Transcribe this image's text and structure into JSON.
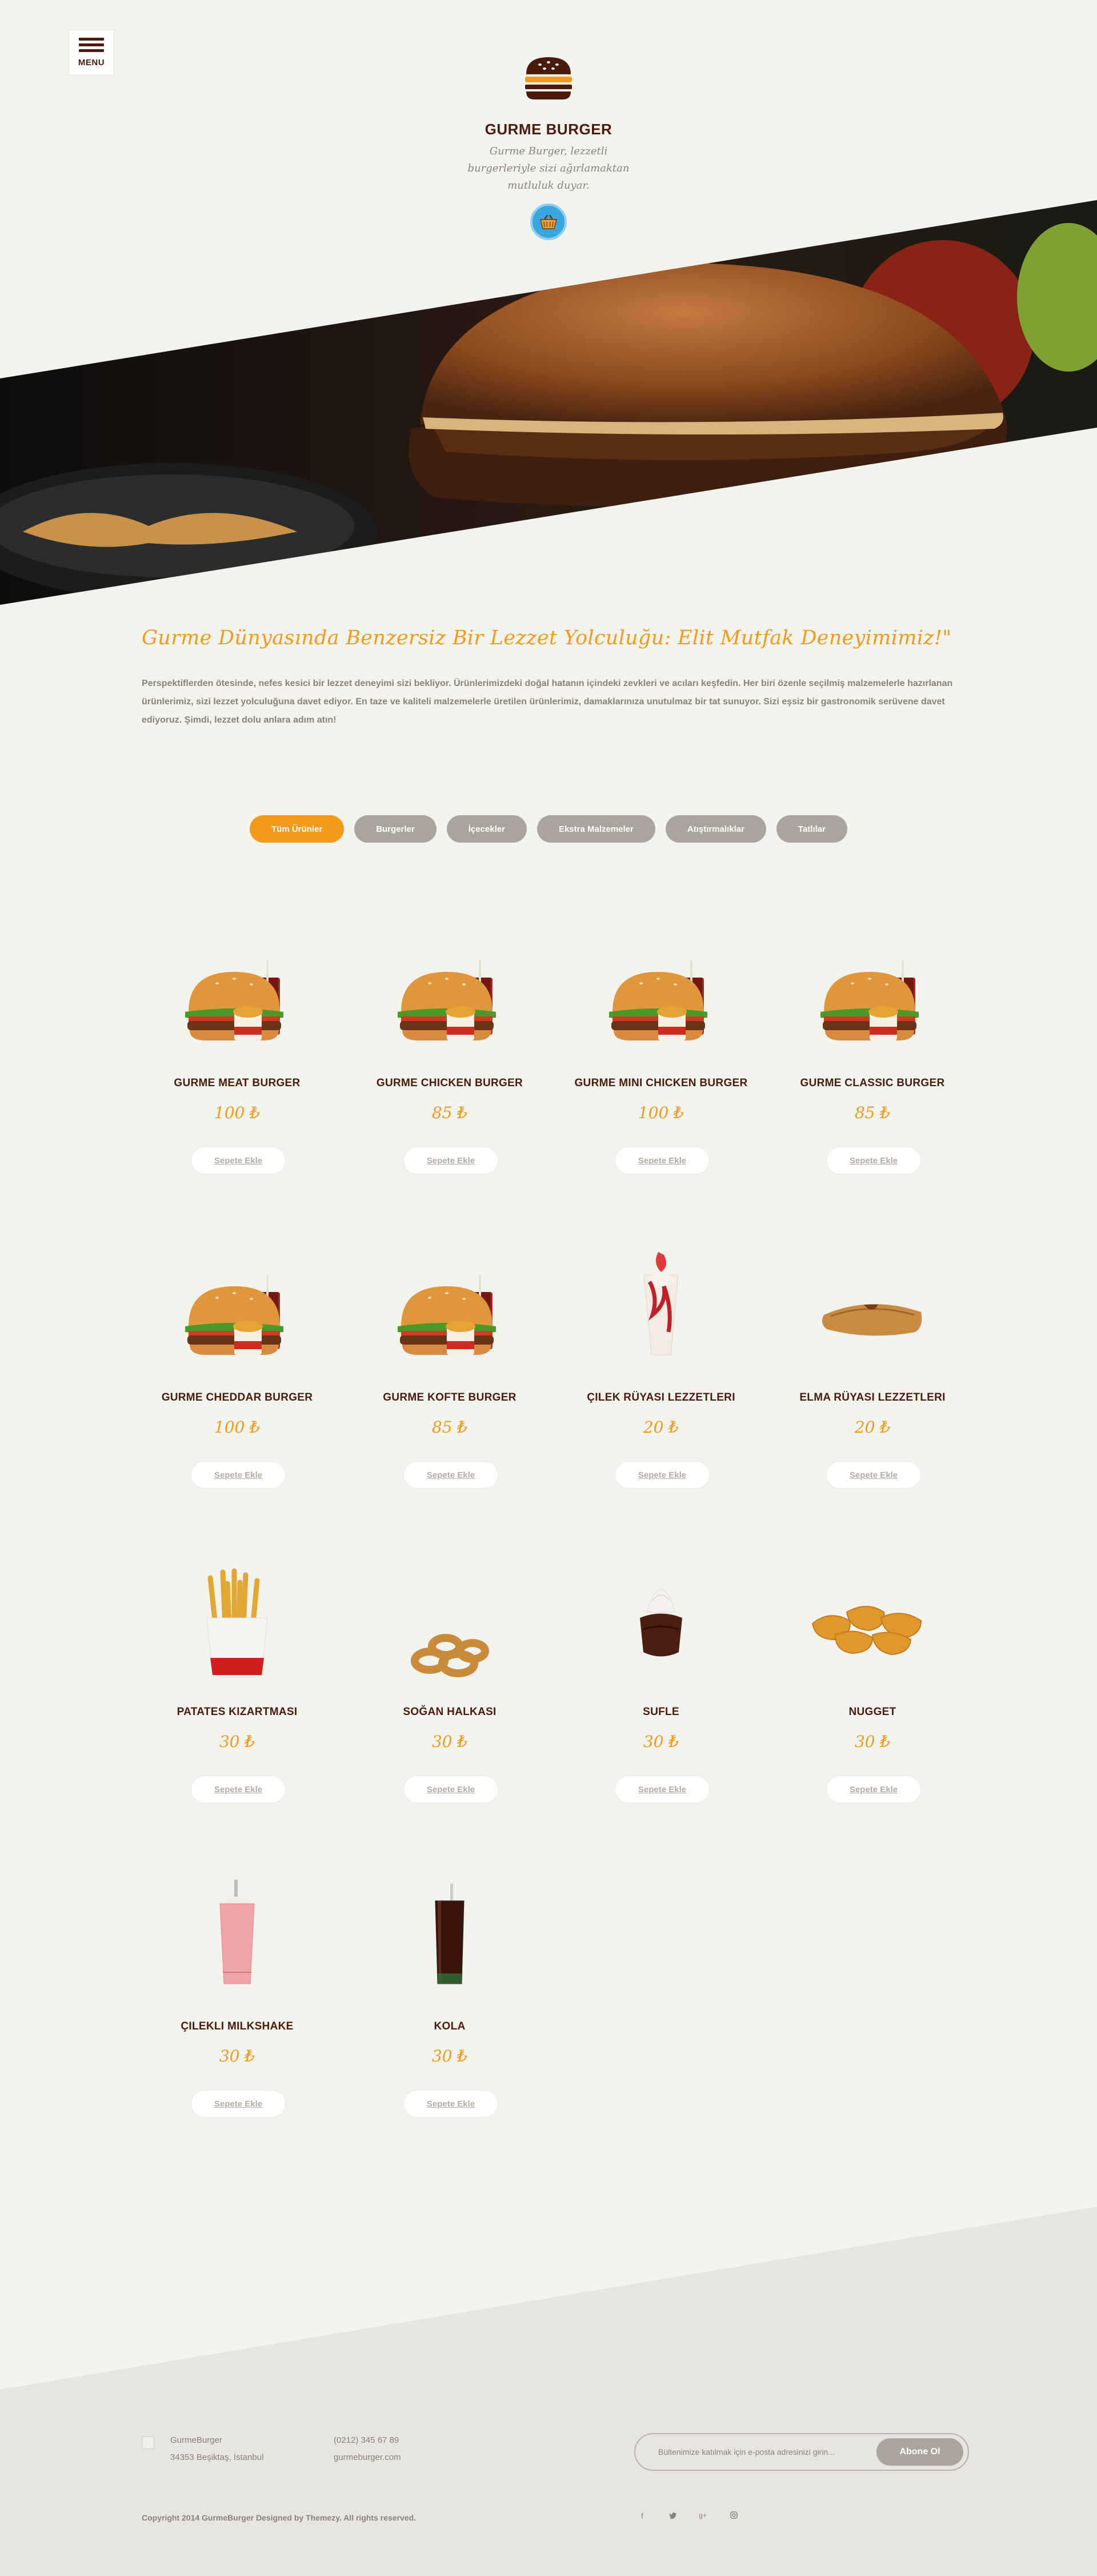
{
  "header": {
    "menu_label": "MENU",
    "brand": "GURME BURGER",
    "tagline": "Gurme Burger, lezzetli burgerleriyle sizi ağırlamaktan mutluluk duyar."
  },
  "intro": {
    "title": "Gurme Dünyasında Benzersiz Bir Lezzet Yolculuğu: Elit Mutfak Deneyimimiz!\"",
    "text": "Perspektiflerden ötesinde, nefes kesici bir lezzet deneyimi sizi bekliyor. Ürünlerimizdeki doğal hatanın içindeki zevkleri ve acıları keşfedin. Her biri özenle seçilmiş malzemelerle hazırlanan ürünlerimiz, sizi lezzet yolculuğuna davet ediyor. En taze ve kaliteli malzemelerle üretilen ürünlerimiz, damaklarınıza unutulmaz bir tat sunuyor. Sizi eşsiz bir gastronomik serüvene davet ediyoruz. Şimdi, lezzet dolu anlara adım atın!"
  },
  "filters": [
    "Tüm Ürünler",
    "Burgerler",
    "İçecekler",
    "Ekstra Malzemeler",
    "Atıştırmalıklar",
    "Tatlılar"
  ],
  "add_label": "Sepete Ekle",
  "products": [
    {
      "name": "GURME MEAT BURGER",
      "price": "100 ₺",
      "icon": "burger-combo"
    },
    {
      "name": "GURME CHICKEN BURGER",
      "price": "85 ₺",
      "icon": "burger-combo"
    },
    {
      "name": "GURME MINI CHICKEN BURGER",
      "price": "100 ₺",
      "icon": "burger-combo"
    },
    {
      "name": "GURME CLASSIC BURGER",
      "price": "85 ₺",
      "icon": "burger-combo"
    },
    {
      "name": "GURME CHEDDAR BURGER",
      "price": "100 ₺",
      "icon": "burger-combo"
    },
    {
      "name": "GURME KOFTE BURGER",
      "price": "85 ₺",
      "icon": "burger-combo"
    },
    {
      "name": "ÇILEK RÜYASI LEZZETLERI",
      "price": "20 ₺",
      "icon": "sundae"
    },
    {
      "name": "ELMA RÜYASI LEZZETLERI",
      "price": "20 ₺",
      "icon": "apple-pie"
    },
    {
      "name": "PATATES KIZARTMASI",
      "price": "30 ₺",
      "icon": "fries"
    },
    {
      "name": "SOĞAN HALKASI",
      "price": "30 ₺",
      "icon": "onion-rings"
    },
    {
      "name": "SUFLE",
      "price": "30 ₺",
      "icon": "souffle"
    },
    {
      "name": "NUGGET",
      "price": "30 ₺",
      "icon": "nuggets"
    },
    {
      "name": "ÇILEKLI MILKSHAKE",
      "price": "30 ₺",
      "icon": "milkshake"
    },
    {
      "name": "KOLA",
      "price": "30 ₺",
      "icon": "cola"
    }
  ],
  "footer": {
    "company": "GurmeBurger",
    "address": "34353 Beşiktaş, İstanbul",
    "phone": "(0212) 345 67 89",
    "website": "gurmeburger.com",
    "newsletter_placeholder": "Bültenimize katılmak için e-posta adresinizi girin...",
    "subscribe_label": "Abone Ol",
    "copyright": "Copyright 2014 GurmeBurger Designed by Themezy. All rights reserved."
  },
  "colors": {
    "accent": "#f39a1a",
    "brown": "#4a1a0c",
    "muted": "#aaa49b",
    "background": "#f3f3ee"
  }
}
